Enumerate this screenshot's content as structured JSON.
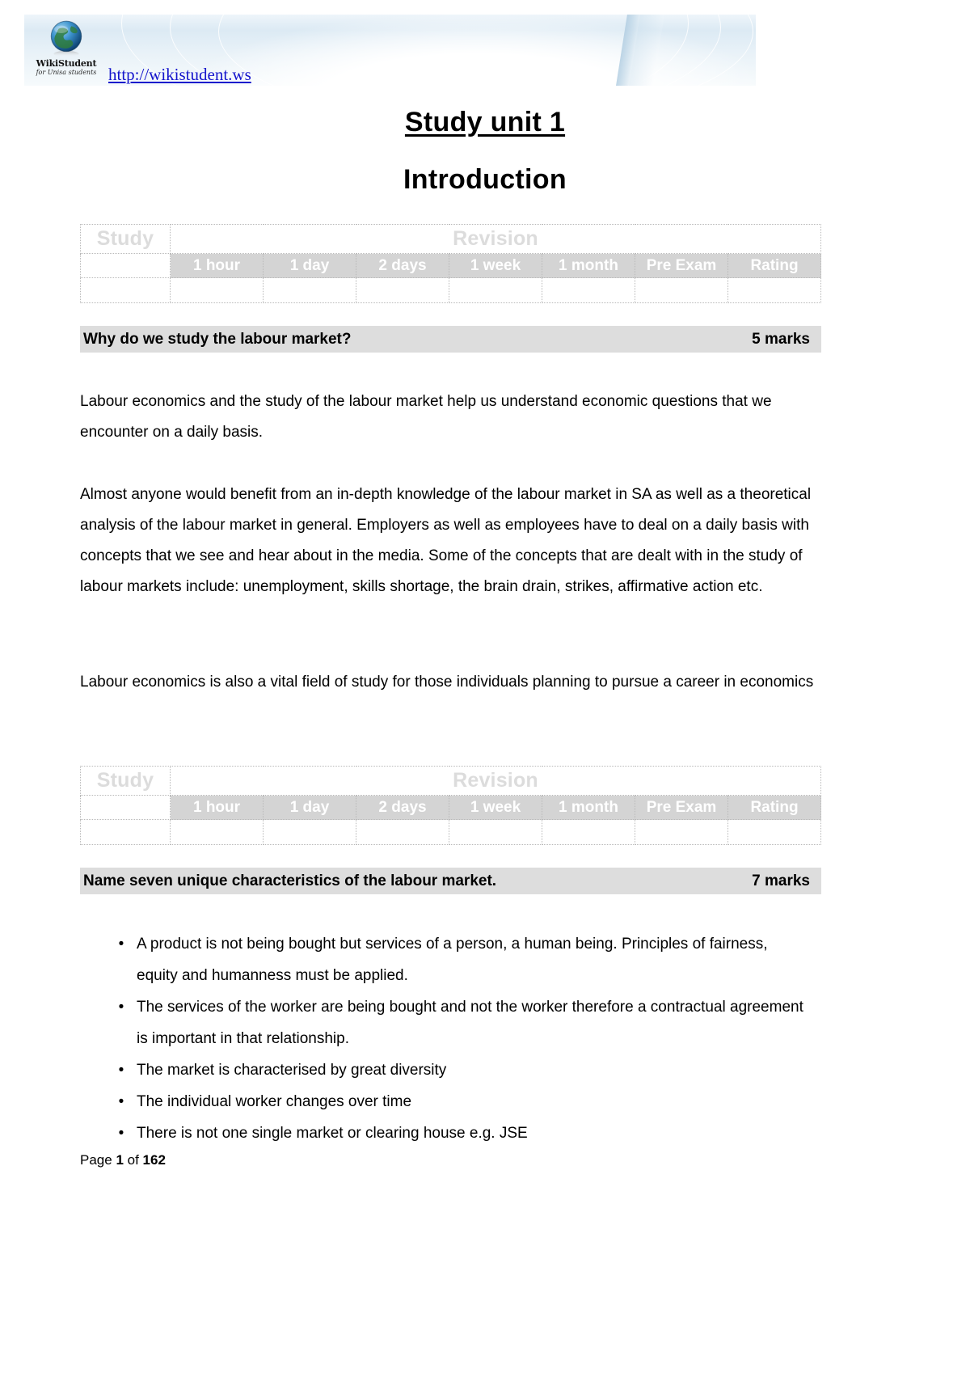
{
  "header": {
    "logo_name": "WikiStudent",
    "logo_tagline": "for Unisa students",
    "url": "http://wikistudent.ws",
    "globe_icon": "globe-icon"
  },
  "title": {
    "unit": "Study unit 1",
    "subtitle": "Introduction"
  },
  "study_table": {
    "study_label": "Study",
    "revision_label": "Revision",
    "intervals": [
      "1 hour",
      "1 day",
      "2 days",
      "1 week",
      "1 month",
      "Pre Exam",
      "Rating"
    ],
    "entry_row": [
      "",
      "",
      "",
      "",
      "",
      "",
      "",
      ""
    ]
  },
  "questions": [
    {
      "text": "Why do we study the labour market?",
      "marks": "5 marks",
      "paragraphs": [
        "Labour economics and the study of the labour market help us understand economic questions that we encounter on a daily basis.",
        "Almost anyone would benefit from an in-depth knowledge of the labour market in SA as well as a theoretical analysis of the labour market in general. Employers as well as employees have to deal on a daily basis with concepts that we see and hear about in the media. Some of the concepts that are dealt with in the study of labour markets include: unemployment, skills shortage, the brain drain, strikes, affirmative action etc.",
        "Labour economics is also a vital field of study for those individuals planning to pursue a career in economics"
      ]
    },
    {
      "text": "Name seven unique characteristics of the labour market.",
      "marks": "7 marks",
      "bullets": [
        "A product is not being bought but services of a person, a human being. Principles of fairness, equity and humanness must be applied.",
        "The services of the worker are being bought and not the worker therefore a contractual agreement is important in that relationship.",
        "The market is characterised by great diversity",
        "The individual worker changes over time",
        "There is not one single market or clearing house e.g. JSE"
      ],
      "bullet_marker": "•"
    }
  ],
  "footer": {
    "prefix": "Page ",
    "current_page": "1",
    "middle": " of ",
    "total_pages": "162"
  },
  "colors": {
    "banner_gray": "#dddddd",
    "table_subhead_gray": "#d4d4d4",
    "table_head_text": "#dcdcdc",
    "link_blue": "#1414cc"
  }
}
